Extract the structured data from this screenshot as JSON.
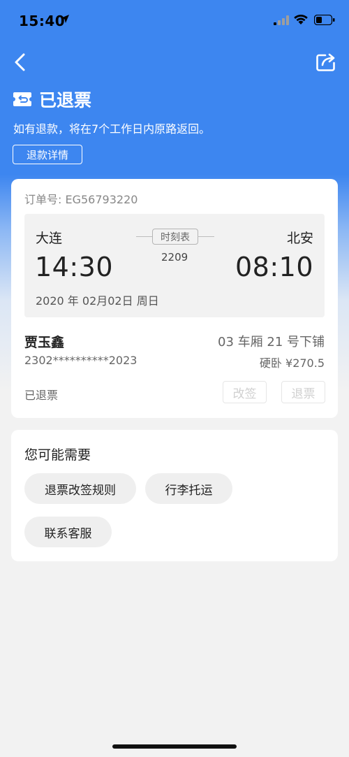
{
  "status_bar": {
    "time": "15:40",
    "location_icon": "location-arrow-icon",
    "signal_icon": "cellular-signal-icon",
    "wifi_icon": "wifi-icon",
    "battery_icon": "battery-icon"
  },
  "nav": {
    "back_icon": "chevron-left-icon",
    "share_icon": "share-icon"
  },
  "header": {
    "status_icon": "ticket-icon",
    "status_title": "已退票",
    "refund_note": "如有退款，将在7个工作日内原路返回。",
    "refund_detail_label": "退款详情"
  },
  "order": {
    "order_no": "订单号: EG56793220",
    "departure_station": "大连",
    "arrival_station": "北安",
    "departure_time": "14:30",
    "arrival_time": "08:10",
    "timetable_label": "时刻表",
    "train_no": "2209",
    "date": "2020 年 02月02日 周日",
    "passenger_name": "贾玉鑫",
    "seat": "03 车厢 21 号下铺",
    "id_number": "2302**********2023",
    "seat_type_price": "硬卧 ¥270.5",
    "ticket_status": "已退票",
    "change_label": "改签",
    "refund_label": "退票"
  },
  "suggestions": {
    "title": "您可能需要",
    "items": [
      "退票改签规则",
      "行李托运",
      "联系客服"
    ]
  },
  "colors": {
    "brand_blue": "#3d86f0",
    "page_bg": "#f2f2f2",
    "card_bg": "#ffffff"
  }
}
